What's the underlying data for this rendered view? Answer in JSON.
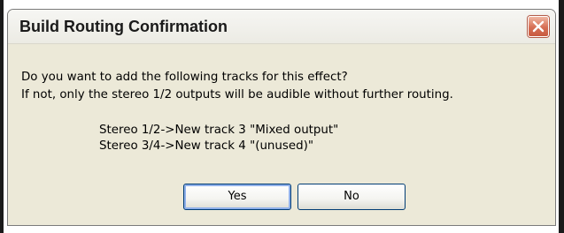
{
  "dialog": {
    "title": "Build Routing Confirmation",
    "close_icon": "close-icon",
    "message_lines": [
      "Do you want to add the following tracks for this effect?",
      "If not, only the stereo 1/2 outputs will be audible without further routing."
    ],
    "tracks": [
      "Stereo 1/2->New track 3 \"Mixed output\"",
      "Stereo 3/4->New track 4 \"(unused)\""
    ],
    "buttons": {
      "yes_label": "Yes",
      "no_label": "No"
    },
    "colors": {
      "dialog_background": "#ece9d8",
      "close_button": "#d66f55",
      "default_button_border": "#003c74"
    }
  }
}
